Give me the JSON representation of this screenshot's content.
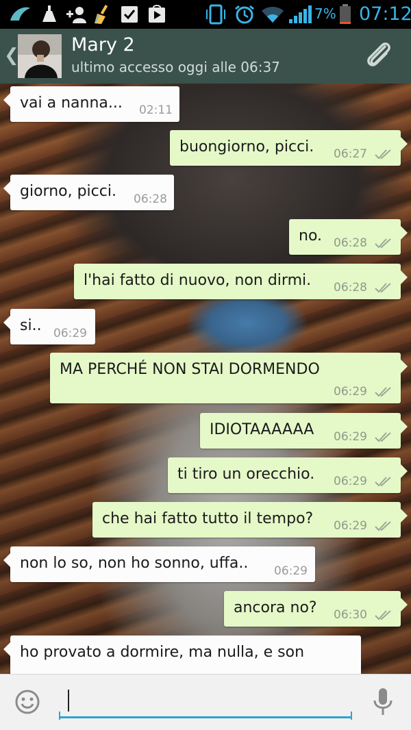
{
  "status_bar": {
    "icons": [
      "app-icon",
      "clean-icon",
      "add-contact-icon",
      "broom-icon",
      "checkbox-icon",
      "play-store-icon",
      "phone-vibrate-icon",
      "alarm-icon",
      "wifi-icon",
      "signal-icon",
      "battery-icon"
    ],
    "battery": "7%",
    "time": "07:12",
    "accent": "#3ab4e8"
  },
  "header": {
    "contact_name": "Mary 2",
    "last_seen": "ultimo accesso oggi alle 06:37",
    "bg": "#3a524b"
  },
  "messages": [
    {
      "dir": "in",
      "text": "vai a nanna...",
      "time": "02:11"
    },
    {
      "dir": "out",
      "text": "buongiorno, picci.",
      "time": "06:27",
      "ticks": "double"
    },
    {
      "dir": "in",
      "text": "giorno, picci.",
      "time": "06:28"
    },
    {
      "dir": "out",
      "text": "no.",
      "time": "06:28",
      "ticks": "double"
    },
    {
      "dir": "out",
      "text": "l'hai fatto di nuovo, non dirmi.",
      "time": "06:28",
      "ticks": "double"
    },
    {
      "dir": "in",
      "text": "si..",
      "time": "06:29"
    },
    {
      "dir": "out",
      "text": "MA PERCHÉ NON STAI DORMENDO",
      "time": "06:29",
      "ticks": "double"
    },
    {
      "dir": "out",
      "text": "IDIOTAAAAAA",
      "time": "06:29",
      "ticks": "double"
    },
    {
      "dir": "out",
      "text": "ti tiro un orecchio.",
      "time": "06:29",
      "ticks": "double"
    },
    {
      "dir": "out",
      "text": "che hai fatto tutto il tempo?",
      "time": "06:29",
      "ticks": "double"
    },
    {
      "dir": "in",
      "text": "non lo so, non ho sonno, uffa..",
      "time": "06:29"
    },
    {
      "dir": "out",
      "text": "ancora no?",
      "time": "06:30",
      "ticks": "double"
    },
    {
      "dir": "in",
      "text": "ho provato a dormire, ma nulla, e son",
      "time": ""
    }
  ],
  "composer": {
    "value": "",
    "accent": "#2ea3cf"
  }
}
